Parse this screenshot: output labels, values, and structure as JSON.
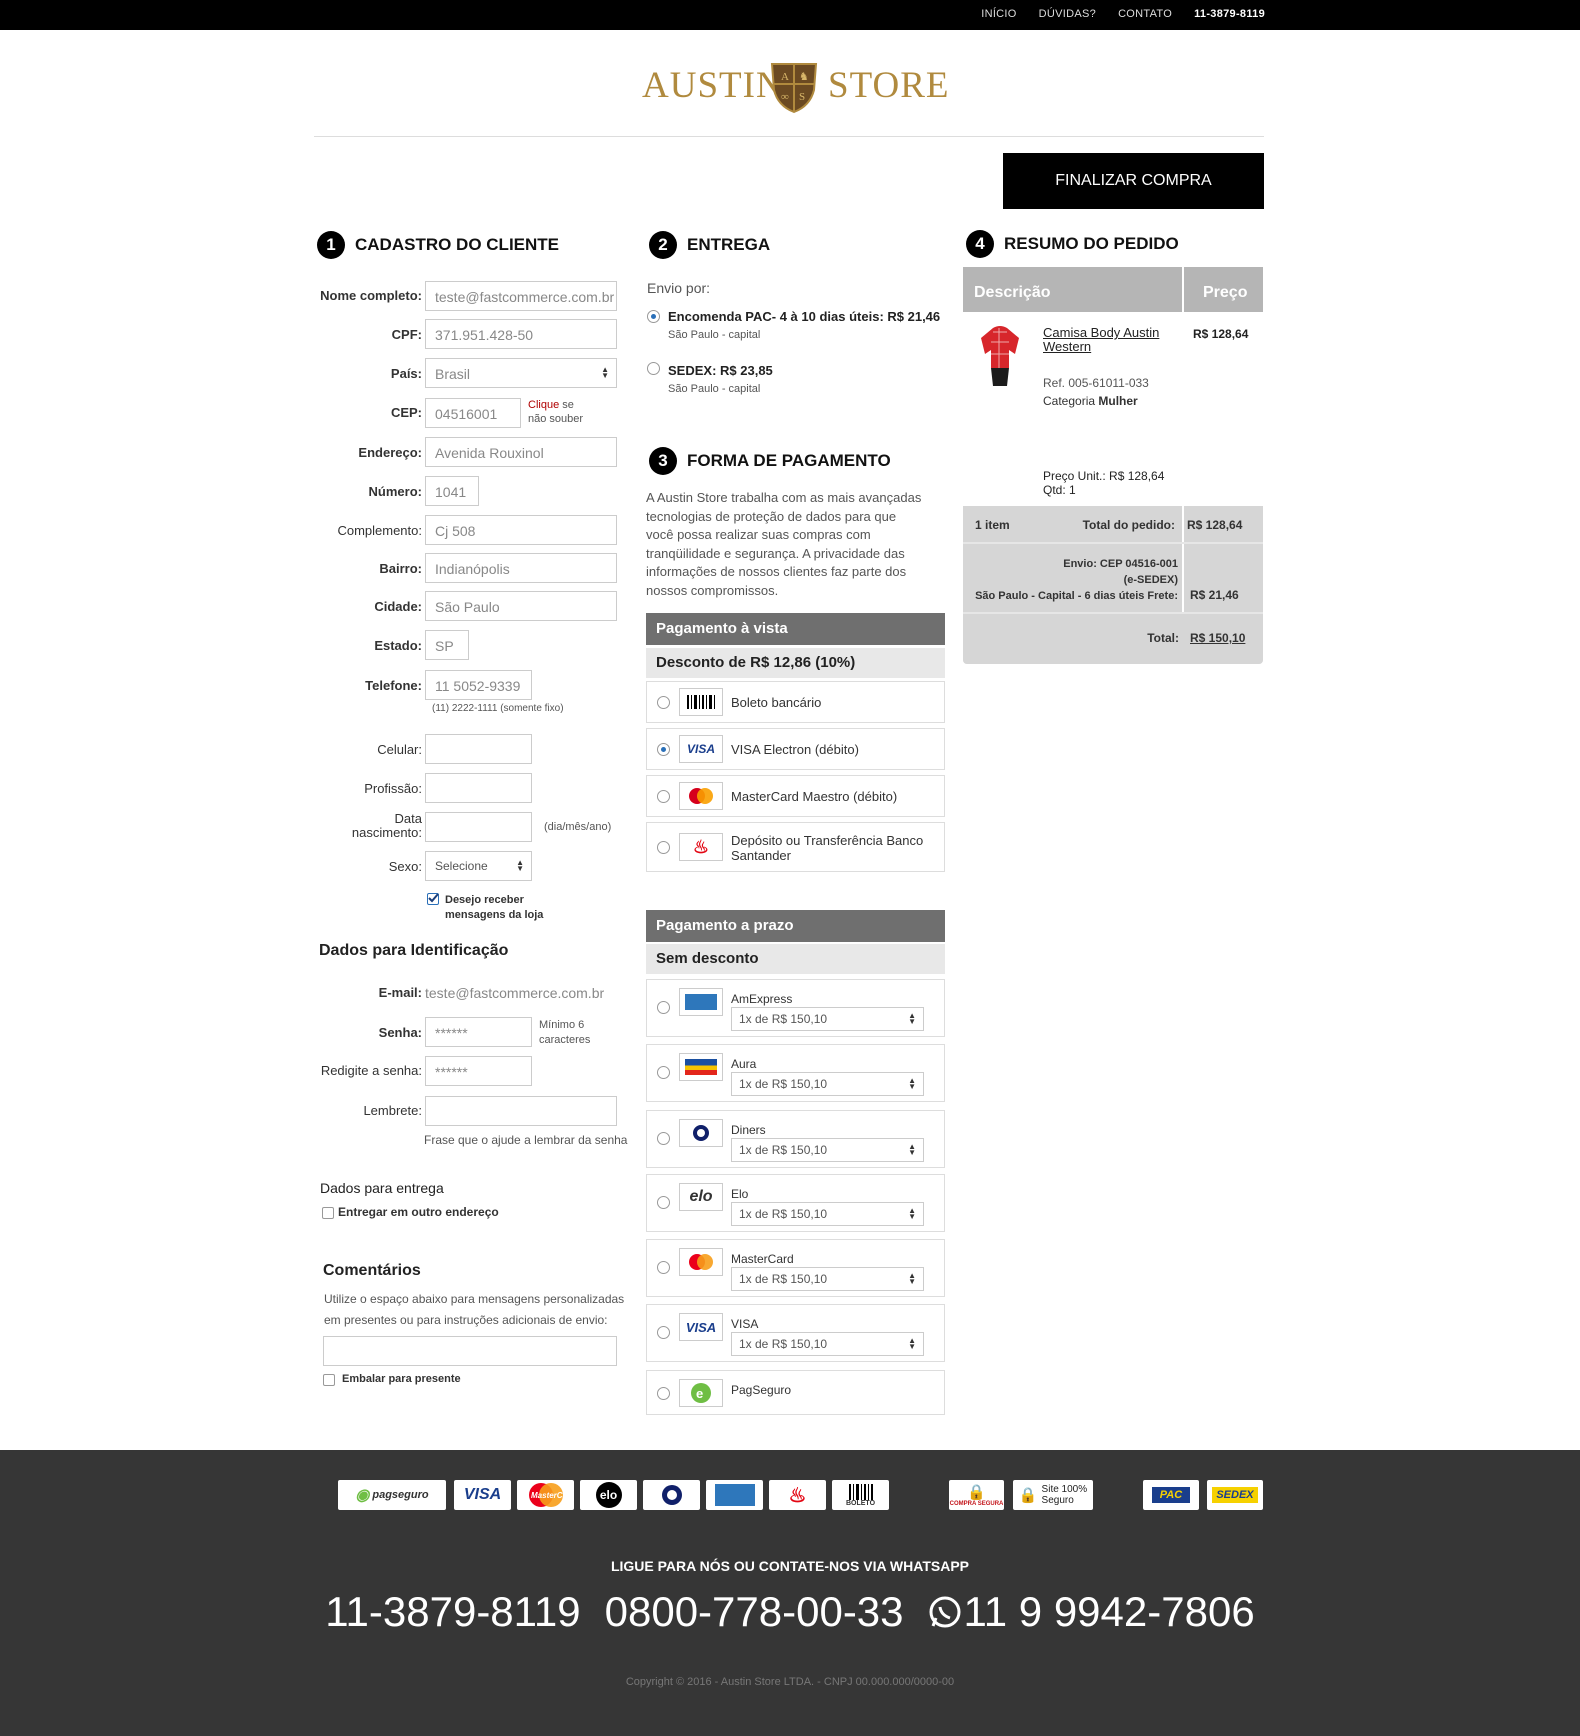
{
  "topnav": {
    "inicio": "INÍCIO",
    "duvidas": "DÚVIDAS?",
    "contato": "CONTATO",
    "phone": "11-3879-8119"
  },
  "logo": {
    "left": "AUSTIN",
    "right": "STORE"
  },
  "finalizar": "FINALIZAR COMPRA",
  "s1": {
    "num": "1",
    "title": "CADASTRO DO CLIENTE",
    "nome_label": "Nome completo:",
    "nome": "teste@fastcommerce.com.br",
    "cpf_label": "CPF:",
    "cpf": "371.951.428-50",
    "pais_label": "País:",
    "pais": "Brasil",
    "cep_label": "CEP:",
    "cep": "04516001",
    "cep_link": "Clique",
    "cep_help1": " se",
    "cep_help2": "não souber",
    "end_label": "Endereço:",
    "end": "Avenida Rouxinol",
    "num_label": "Número:",
    "numero": "1041",
    "comp_label": "Complemento:",
    "comp": "Cj 508",
    "bairro_label": "Bairro:",
    "bairro": "Indianópolis",
    "cidade_label": "Cidade:",
    "cidade": "São Paulo",
    "estado_label": "Estado:",
    "estado": "SP",
    "tel_label": "Telefone:",
    "tel": "11 5052-9339",
    "tel_hint": "(11) 2222-1111 (somente fixo)",
    "cel_label": "Celular:",
    "prof_label": "Profissão:",
    "nasc_label1": "Data",
    "nasc_label2": "nascimento:",
    "nasc_hint": "(dia/mês/ano)",
    "sexo_label": "Sexo:",
    "sexo": "Selecione",
    "news1": "Desejo receber",
    "news2": "mensagens da loja"
  },
  "ident": {
    "title": "Dados para Identificação",
    "email_label": "E-mail:",
    "email": "teste@fastcommerce.com.br",
    "senha_label": "Senha:",
    "senha": "******",
    "senha_hint1": "Mínimo 6",
    "senha_hint2": "caracteres",
    "resenha_label": "Redigite a senha:",
    "resenha": "******",
    "lembrete_label": "Lembrete:",
    "lembrete_hint": "Frase que o ajude a lembrar da senha"
  },
  "entrega_dados": {
    "title": "Dados para entrega",
    "outro": "Entregar em outro endereço"
  },
  "coment": {
    "title": "Comentários",
    "desc1": "Utilize o espaço abaixo para mensagens personalizadas",
    "desc2": "em presentes ou para instruções adicionais de envio:",
    "embalar": "Embalar para presente"
  },
  "s2": {
    "num": "2",
    "title": "ENTREGA",
    "envio": "Envio por:",
    "opt1": "Encomenda PAC- 4 à 10 dias úteis: R$ 21,46",
    "opt1_sub": "São Paulo - capital",
    "opt2": "SEDEX: R$ 23,85",
    "opt2_sub": "São Paulo - capital"
  },
  "s3": {
    "num": "3",
    "title": "FORMA DE PAGAMENTO",
    "desc": [
      "A Austin Store trabalha com as mais avançadas",
      "tecnologias de proteção de dados para que",
      "você possa realizar suas compras com",
      "tranqüilidade e segurança. A privacidade das",
      "informações de nossos clientes faz parte dos",
      "nossos compromissos."
    ],
    "vista": "Pagamento à vista",
    "desconto": "Desconto de R$ 12,86 (10%)",
    "boleto": "Boleto bancário",
    "visa_e": "VISA Electron (débito)",
    "maestro": "MasterCard Maestro (débito)",
    "deposito1": "Depósito ou Transferência Banco",
    "deposito2": "Santander",
    "prazo": "Pagamento a prazo",
    "sem": "Sem desconto",
    "parcela": "1x de R$ 150,10",
    "amex": "AmExpress",
    "aura": "Aura",
    "diners": "Diners",
    "elo": "Elo",
    "master": "MasterCard",
    "visa": "VISA",
    "pagseguro": "PagSeguro"
  },
  "s4": {
    "num": "4",
    "title": "RESUMO DO PEDIDO",
    "col1": "Descrição",
    "col2": "Preço",
    "prod1": "Camisa Body Austin",
    "prod2": "Western",
    "prod_price": "R$ 128,64",
    "ref": "Ref. 005-61011-033",
    "cat_label": "Categoria ",
    "cat": "Mulher",
    "unit": "Preço Unit.: R$ 128,64",
    "qtd": "Qtd: 1",
    "items": "1 item",
    "total_label": "Total do pedido:",
    "total": "R$ 128,64",
    "envio1": "Envio: CEP 04516-001",
    "envio2": "(e-SEDEX)",
    "envio3": "São Paulo - Capital - 6 dias úteis  Frete:",
    "frete": "R$ 21,46",
    "grand_label": "Total:",
    "grand": "R$ 150,10"
  },
  "footer": {
    "call": "LIGUE PARA NÓS OU CONTATE-NOS VIA WHATSAPP",
    "tel1": "11-3879-8119",
    "tel2": "0800-778-00-33",
    "tel3": "11 9 9942-7806",
    "copy": "Copyright © 2016 - Austin Store  LTDA. - CNPJ 00.000.000/0000-00",
    "pagseguro": "pagseguro",
    "visa": "VISA",
    "master": "MasterCard",
    "elo": "elo",
    "boleto": "BOLETO",
    "site1": "Site 100%",
    "site2": "Seguro",
    "pac": "PAC",
    "sedex": "SEDEX",
    "compra": "COMPRA SEGURA"
  }
}
